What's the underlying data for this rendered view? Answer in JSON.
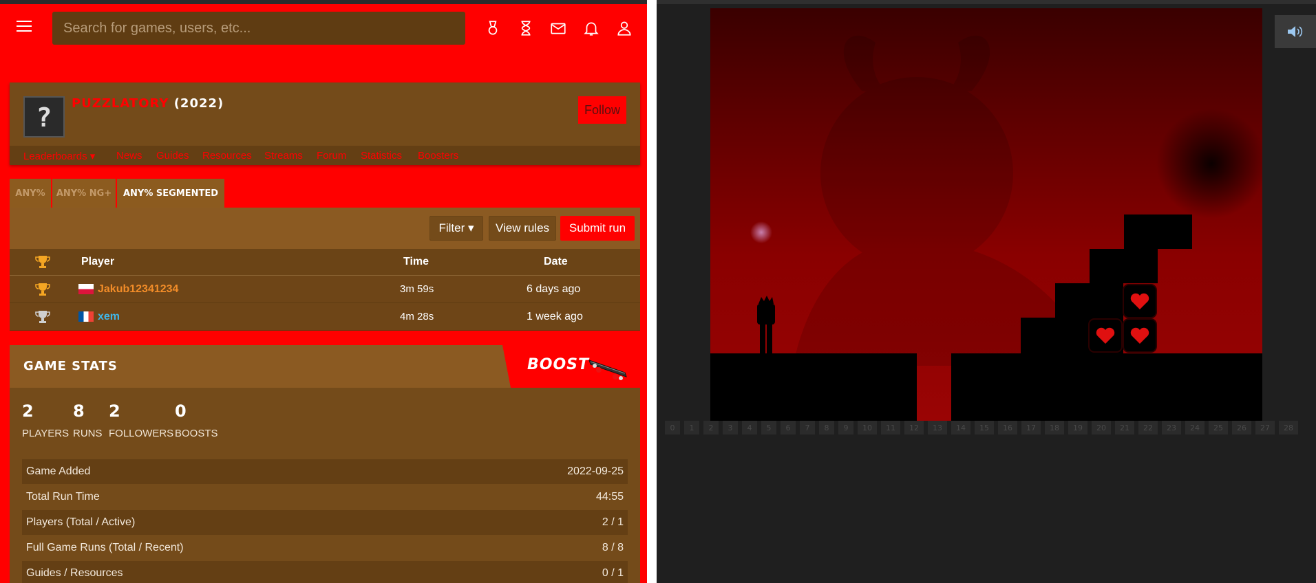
{
  "header": {
    "search_placeholder": "Search for games, users, etc..."
  },
  "game": {
    "name": "PUZZLATORY",
    "year": "(2022)",
    "follow_label": "Follow",
    "nav": [
      "Leaderboards ▾",
      "News",
      "Guides",
      "Resources",
      "Streams",
      "Forum",
      "Statistics",
      "Boosters"
    ]
  },
  "categories": [
    "ANY%",
    "ANY% NG+",
    "ANY% SEGMENTED"
  ],
  "leaderboard": {
    "filter_label": "Filter ▾",
    "view_rules_label": "View rules",
    "submit_label": "Submit run",
    "columns": [
      "Player",
      "Time",
      "Date"
    ],
    "rows": [
      {
        "player": "Jakub12341234",
        "time": "3m 59s",
        "date": "6 days ago",
        "color": "#f28c28"
      },
      {
        "player": "xem",
        "time": "4m 28s",
        "date": "1 week ago",
        "color": "#3fb6e8"
      }
    ]
  },
  "stats": {
    "title": "GAME STATS",
    "boost_label": "BOOST",
    "counters": [
      {
        "value": "2",
        "label": "PLAYERS"
      },
      {
        "value": "8",
        "label": "RUNS"
      },
      {
        "value": "2",
        "label": "FOLLOWERS"
      },
      {
        "value": "0",
        "label": "BOOSTS"
      }
    ],
    "rows": [
      {
        "label": "Game Added",
        "value": "2022-09-25"
      },
      {
        "label": "Total Run Time",
        "value": "44:55"
      },
      {
        "label": "Players (Total / Active)",
        "value": "2 / 1"
      },
      {
        "label": "Full Game Runs (Total / Recent)",
        "value": "8 / 8"
      },
      {
        "label": "Guides / Resources",
        "value": "0 / 1"
      }
    ]
  },
  "level_selector": [
    "0",
    "1",
    "2",
    "3",
    "4",
    "5",
    "6",
    "7",
    "8",
    "9",
    "10",
    "11",
    "12",
    "13",
    "14",
    "15",
    "16",
    "17",
    "18",
    "19",
    "20",
    "21",
    "22",
    "23",
    "24",
    "25",
    "26",
    "27",
    "28"
  ],
  "colors": {
    "accent": "#ff0000",
    "panel": "#744b1a",
    "game_bg": "#8a0000"
  }
}
